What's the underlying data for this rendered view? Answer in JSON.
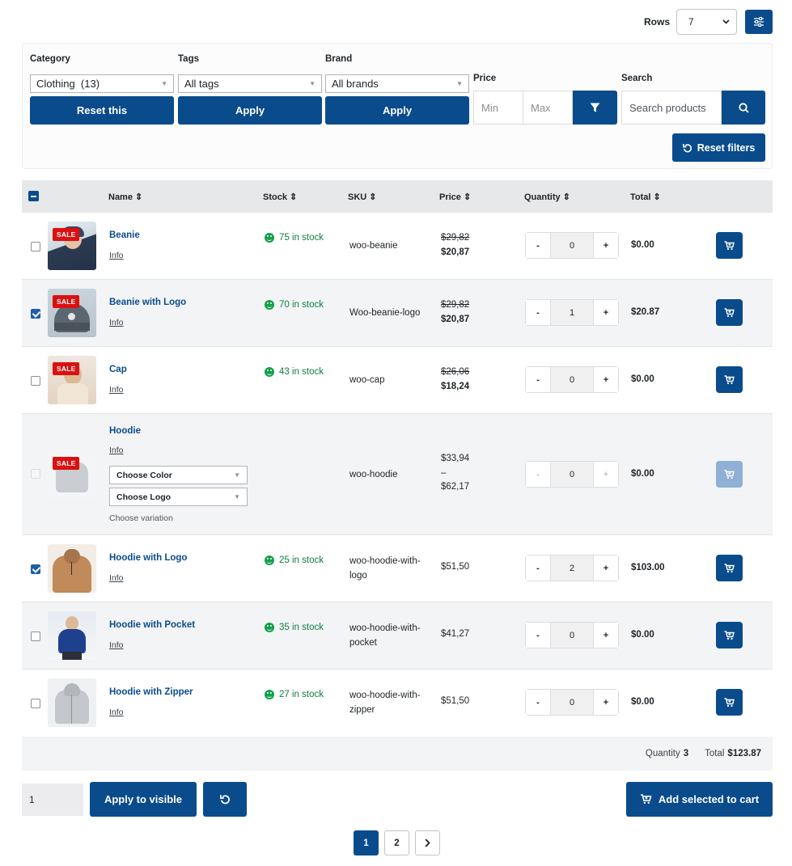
{
  "rows_control": {
    "label": "Rows",
    "value": "7"
  },
  "filters": {
    "category": {
      "label": "Category",
      "value": "Clothing  (13)",
      "reset_label": "Reset this"
    },
    "tags": {
      "label": "Tags",
      "value": "All tags",
      "apply_label": "Apply"
    },
    "brand": {
      "label": "Brand",
      "value": "All brands",
      "apply_label": "Apply"
    },
    "price": {
      "label": "Price",
      "min_placeholder": "Min",
      "max_placeholder": "Max"
    },
    "search": {
      "label": "Search",
      "placeholder": "Search products"
    },
    "reset_all_label": "Reset filters"
  },
  "table": {
    "headers": {
      "name": "Name",
      "stock": "Stock",
      "sku": "SKU",
      "price": "Price",
      "quantity": "Quantity",
      "total": "Total"
    },
    "sort_glyph": "⇕",
    "rows": [
      {
        "name": "Beanie",
        "info": "Info",
        "sale": "SALE",
        "stock": "75 in stock",
        "sku": "woo-beanie",
        "price_old": "$29,82",
        "price_new": "$20,87",
        "qty": "0",
        "total": "$0.00",
        "checked": false
      },
      {
        "name": "Beanie with Logo",
        "info": "Info",
        "sale": "SALE",
        "stock": "70 in stock",
        "sku": "Woo-beanie-logo",
        "price_old": "$29,82",
        "price_new": "$20,87",
        "qty": "1",
        "total": "$20.87",
        "checked": true
      },
      {
        "name": "Cap",
        "info": "Info",
        "sale": "SALE",
        "stock": "43 in stock",
        "sku": "woo-cap",
        "price_old": "$26,06",
        "price_new": "$18,24",
        "qty": "0",
        "total": "$0.00",
        "checked": false
      },
      {
        "name": "Hoodie",
        "info": "Info",
        "sale": "SALE",
        "sku": "woo-hoodie",
        "price_from": "$33,94",
        "price_dash": "–",
        "price_to": "$62,17",
        "qty": "0",
        "total": "$0.00",
        "checked": false,
        "variation": {
          "color_label": "Choose Color",
          "logo_label": "Choose Logo",
          "note": "Choose variation"
        }
      },
      {
        "name": "Hoodie with Logo",
        "info": "Info",
        "stock": "25 in stock",
        "sku_line1": "woo-hoodie-with-",
        "sku_line2": "logo",
        "price": "$51,50",
        "qty": "2",
        "total": "$103.00",
        "checked": true
      },
      {
        "name": "Hoodie with Pocket",
        "info": "Info",
        "stock": "35 in stock",
        "sku_line1": "woo-hoodie-with-",
        "sku_line2": "pocket",
        "price": "$41,27",
        "qty": "0",
        "total": "$0.00",
        "checked": false
      },
      {
        "name": "Hoodie with Zipper",
        "info": "Info",
        "stock": "27 in stock",
        "sku_line1": "woo-hoodie-with-",
        "sku_line2": "zipper",
        "price": "$51,50",
        "qty": "0",
        "total": "$0.00",
        "checked": false
      }
    ],
    "summary": {
      "quantity_label": "Quantity",
      "quantity_value": "3",
      "total_label": "Total",
      "total_value": "$123.87"
    }
  },
  "bottom": {
    "bulk_qty": "1",
    "apply_visible_label": "Apply to visible",
    "add_selected_label": "Add selected to cart"
  },
  "pagination": {
    "pages": [
      "1",
      "2"
    ],
    "current": "1"
  },
  "colors": {
    "primary": "#0a4b8c",
    "sale": "#dc1010",
    "stock": "#0f7d3e"
  },
  "icons": [
    "sliders-icon",
    "funnel-icon",
    "search-icon",
    "undo-icon",
    "cart-icon",
    "chevron-right-icon",
    "smiley-icon"
  ]
}
